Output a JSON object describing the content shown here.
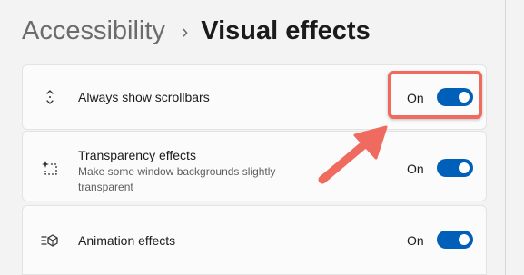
{
  "breadcrumb": {
    "parent": "Accessibility",
    "separator": "›",
    "current": "Visual effects"
  },
  "settings": [
    {
      "title": "Always show scrollbars",
      "description": "",
      "state_label": "On",
      "toggle_on": true,
      "icon": "scrollbar-arrows-icon"
    },
    {
      "title": "Transparency effects",
      "description": "Make some window backgrounds slightly transparent",
      "state_label": "On",
      "toggle_on": true,
      "icon": "transparency-sparkle-icon"
    },
    {
      "title": "Animation effects",
      "description": "",
      "state_label": "On",
      "toggle_on": true,
      "icon": "animation-cube-icon"
    }
  ],
  "colors": {
    "accent": "#005fb8",
    "annotation": "#ef6b5f",
    "background": "#f3f3f3",
    "card": "#fbfbfb"
  }
}
